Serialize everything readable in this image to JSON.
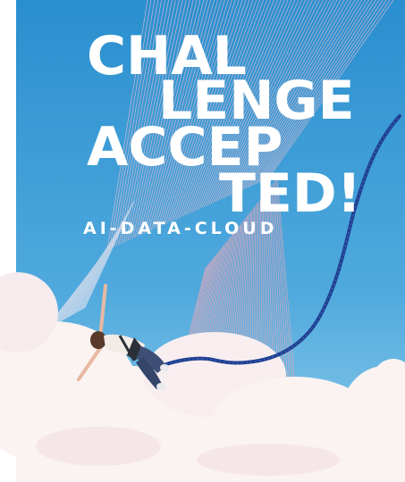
{
  "poster": {
    "headline": [
      "CHAL",
      "LENGE",
      "ACCEP",
      "TED!"
    ],
    "tagline": "AI-DATA-CLOUD",
    "colors": {
      "sky_top": "#2a8fcf",
      "sky_bottom": "#7ec6ea",
      "cloud": "#fbf3f1",
      "line_pink": "#f3a7b4",
      "line_light": "#e8e2ec",
      "rope": "#23449a",
      "text": "#ffffff"
    }
  }
}
